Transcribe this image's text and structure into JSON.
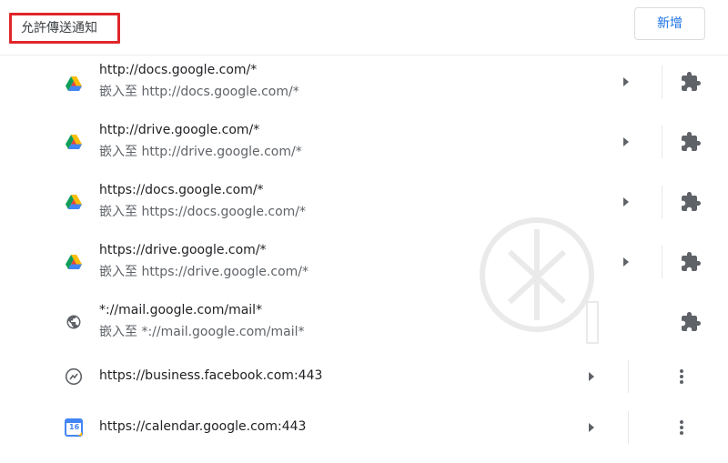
{
  "header": {
    "title": "允許傳送通知",
    "add_label": "新增"
  },
  "rows": [
    {
      "icon": "google-drive-icon",
      "origin": "http://docs.google.com/*",
      "embedded": "嵌入至 http://docs.google.com/*",
      "action_icon": "extension-icon"
    },
    {
      "icon": "google-drive-icon",
      "origin": "http://drive.google.com/*",
      "embedded": "嵌入至 http://drive.google.com/*",
      "action_icon": "extension-icon"
    },
    {
      "icon": "google-drive-icon",
      "origin": "https://docs.google.com/*",
      "embedded": "嵌入至 https://docs.google.com/*",
      "action_icon": "extension-icon"
    },
    {
      "icon": "google-drive-icon",
      "origin": "https://drive.google.com/*",
      "embedded": "嵌入至 https://drive.google.com/*",
      "action_icon": "extension-icon"
    },
    {
      "icon": "globe-icon",
      "origin": "*://mail.google.com/mail*",
      "embedded": "嵌入至 *://mail.google.com/mail*",
      "action_icon": "extension-icon"
    },
    {
      "icon": "messenger-icon",
      "origin": "https://business.facebook.com:443",
      "action_icon": "more-vert-icon"
    },
    {
      "icon": "google-calendar-icon",
      "origin": "https://calendar.google.com:443",
      "action_icon": "more-vert-icon"
    }
  ],
  "calendar_day": "16",
  "colors": {
    "accent": "#1a73e8",
    "highlight_border": "#e0262b",
    "icon_gray": "#5f6368"
  }
}
